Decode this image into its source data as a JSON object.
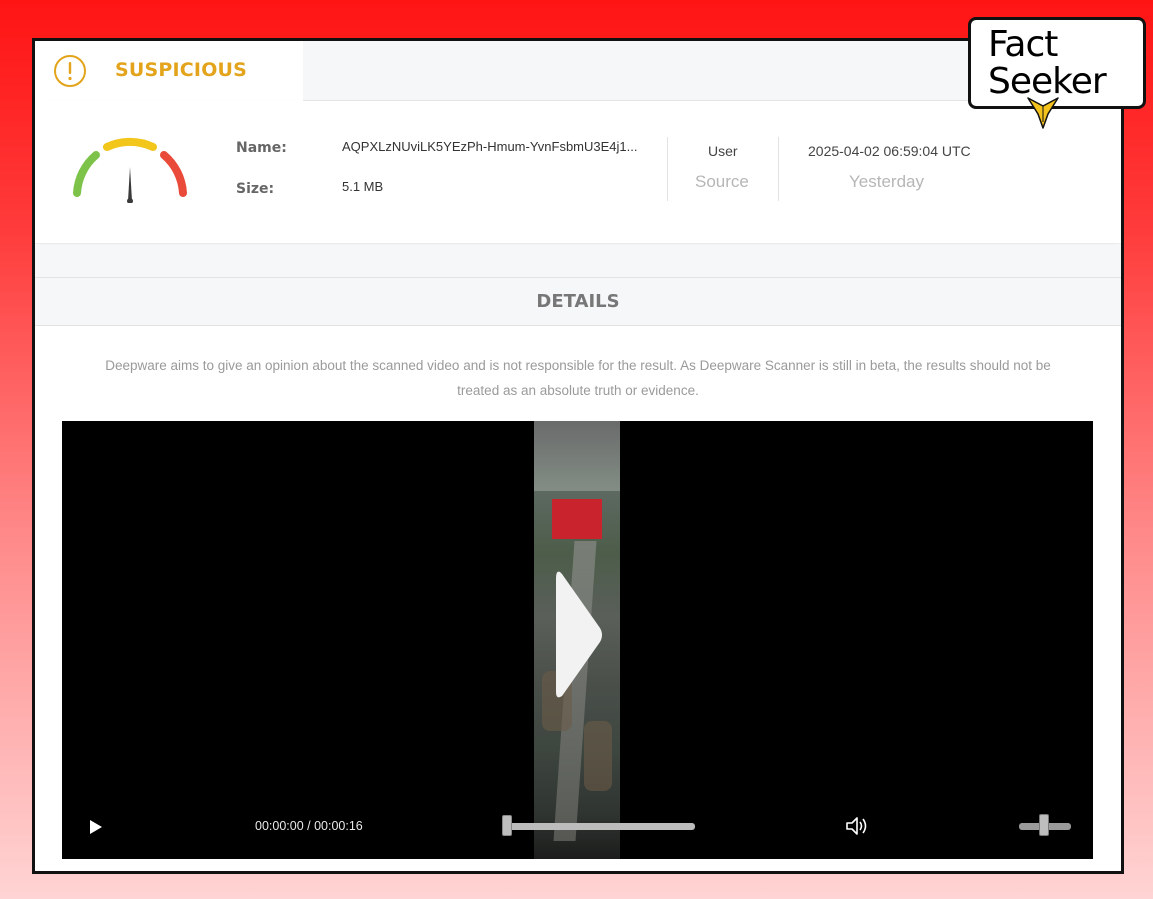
{
  "status": {
    "label": "SUSPICIOUS",
    "icon": "exclamation-circle-icon",
    "color": "#e3a41b"
  },
  "gauge": {
    "icon": "risk-gauge-icon",
    "colors": [
      "#7dc34a",
      "#f2c61b",
      "#e94a3a"
    ]
  },
  "file": {
    "name_label": "Name:",
    "name_value": "AQPXLzNUviLK5YEzPh-Hmum-YvnFsbmU3E4j1...",
    "size_label": "Size:",
    "size_value": "5.1 MB"
  },
  "source": {
    "title": "User",
    "value": "Source"
  },
  "date": {
    "title": "2025-04-02 06:59:04 UTC",
    "value": "Yesterday"
  },
  "details": {
    "heading": "DETAILS",
    "disclaimer_line1": "Deepware aims to give an opinion about the scanned video and is not responsible for the result. As Deepware Scanner is still in beta, the results should not be",
    "disclaimer_line2": "treated as an absolute truth or evidence."
  },
  "video": {
    "time_display": "00:00:00 / 00:00:16",
    "progress": 0.0,
    "volume": 0.5,
    "thumbnail_caption": "",
    "controls": {
      "play_icon": "play-icon",
      "volume_icon": "volume-icon"
    }
  },
  "watermark": {
    "line1": "Fact",
    "line2": "Seeker",
    "icon": "eagle-beak-icon"
  }
}
